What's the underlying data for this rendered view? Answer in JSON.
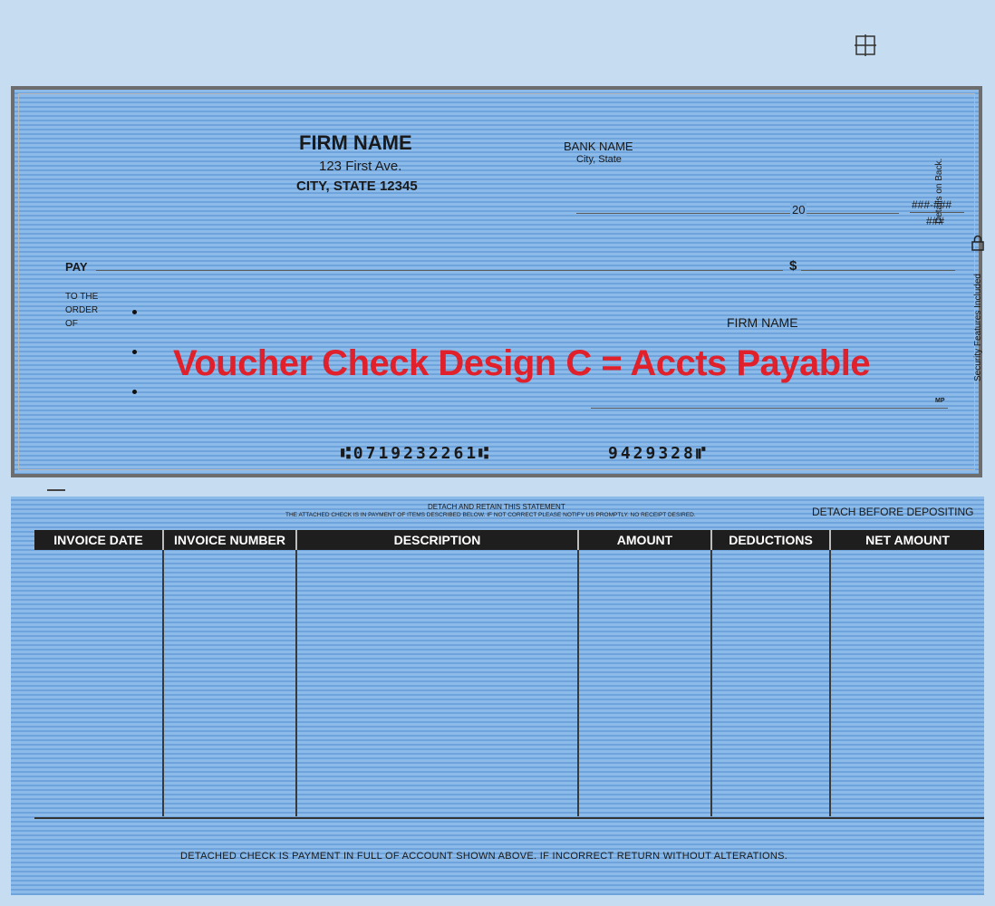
{
  "check": {
    "firm_name": "FIRM NAME",
    "firm_address": "123 First Ave.",
    "firm_city": "CITY, STATE 12345",
    "bank_name": "BANK NAME",
    "bank_city": "City, State",
    "date_year": "20",
    "fraction_top": "###-###",
    "fraction_bottom": "###",
    "pay_label": "PAY",
    "dollar_sign": "$",
    "to_the_order_line1": "TO THE",
    "to_the_order_line2": "ORDER",
    "to_the_order_line3": "OF",
    "signature_firm": "FIRM NAME",
    "mp_mark": "MP",
    "overlay_title": "Voucher Check Design C = Accts Payable",
    "micr_routing": "⑆0719232261⑆",
    "micr_account": "9429328⑈",
    "side_text_top": "Details on Back.",
    "side_text_bottom": "Security Features Included",
    "overlay_color": "#e0202a"
  },
  "voucher": {
    "detach_title": "DETACH AND RETAIN THIS STATEMENT",
    "detach_subtitle": "THE ATTACHED CHECK IS IN PAYMENT OF ITEMS DESCRIBED BELOW.  IF NOT CORRECT PLEASE NOTIFY US PROMPTLY.  NO RECEIPT DESIRED.",
    "detach_before": "DETACH BEFORE DEPOSITING",
    "columns": [
      "INVOICE DATE",
      "INVOICE NUMBER",
      "DESCRIPTION",
      "AMOUNT",
      "DEDUCTIONS",
      "NET AMOUNT"
    ],
    "footer": "DETACHED CHECK IS PAYMENT IN FULL OF ACCOUNT SHOWN ABOVE. IF INCORRECT RETURN WITHOUT ALTERATIONS."
  }
}
